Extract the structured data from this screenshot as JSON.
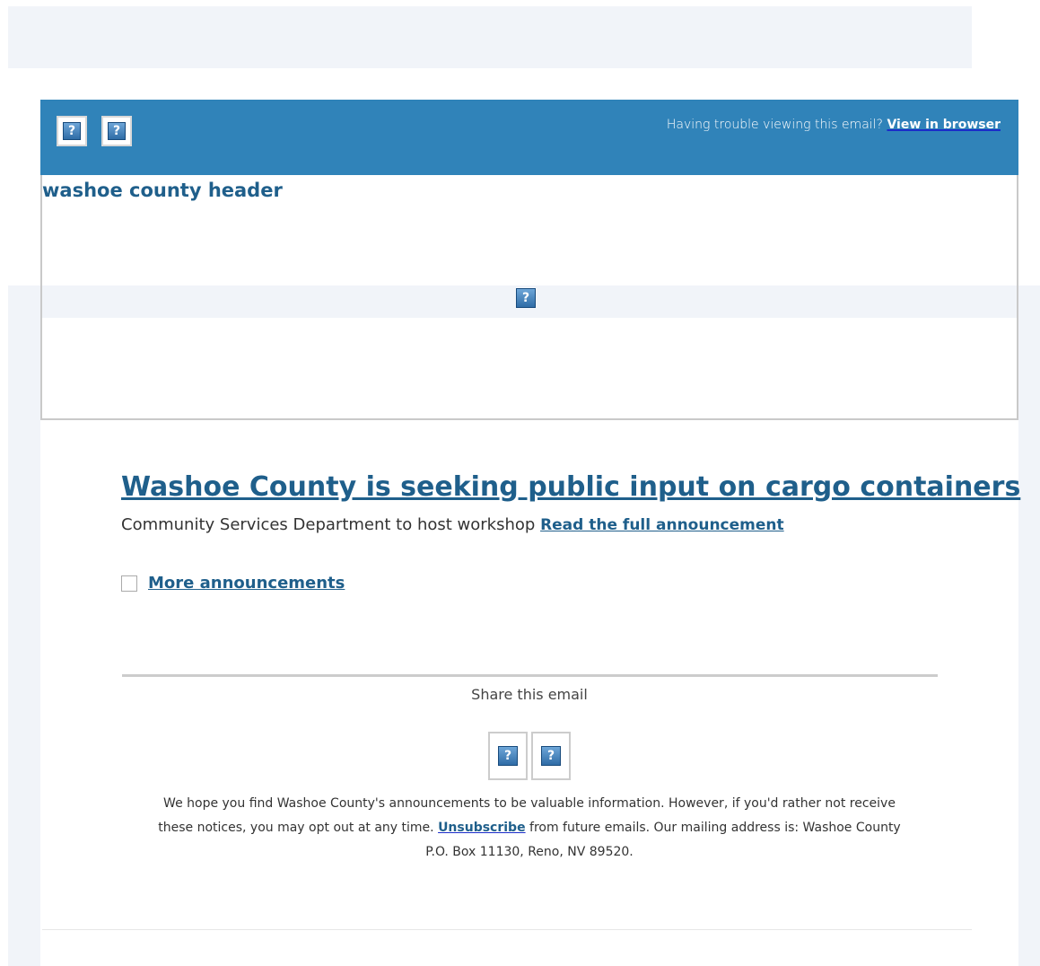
{
  "header": {
    "trouble_text": "Having trouble viewing this email?",
    "view_in_browser": "View in browser",
    "header_image_alt": "washoe county header",
    "icon_glyph": "?"
  },
  "article": {
    "headline": "Washoe County is seeking public input on cargo containers",
    "subtitle": "Community Services Department to host workshop",
    "read_more": "Read the full announcement",
    "more_announcements": "More announcements"
  },
  "share": {
    "label": "Share this email",
    "icons": [
      "broken-image-icon",
      "broken-image-icon"
    ]
  },
  "footer": {
    "text_before_link": "We hope you find Washoe County's announcements to be valuable information. However, if you'd rather not receive these notices, you may opt out at any time.",
    "unsubscribe": "Unsubscribe",
    "text_after_link": "from future emails. Our mailing address is: Washoe County",
    "address_line": "P.O. Box 11130, Reno, NV 89520."
  },
  "colors": {
    "header_bar": "#3083b9",
    "link": "#1f5f8b",
    "band": "#f1f4f9"
  }
}
